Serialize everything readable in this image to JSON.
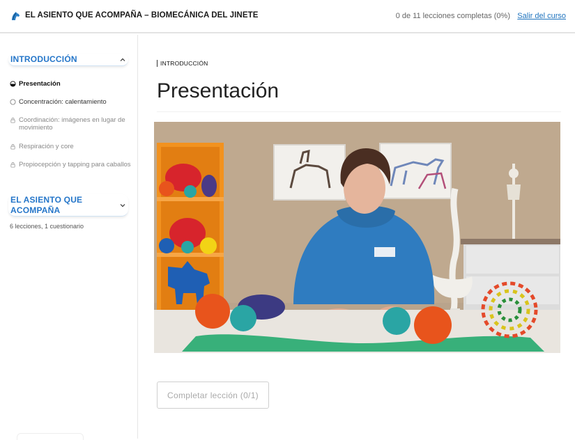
{
  "header": {
    "course_title": "EL ASIENTO QUE ACOMPAÑA – BIOMECÁNICA DEL JINETE",
    "progress": "0 de 11 lecciones completas (0%)",
    "exit_link": "Salir del curso",
    "logo_icon": "horse-head-logo-icon"
  },
  "sidebar": {
    "sections": [
      {
        "title": "INTRODUCCIÓN",
        "expanded": true,
        "chevron_icon": "chevron-up-icon",
        "lessons": [
          {
            "label": "Presentación",
            "state": "current",
            "icon": "half-circle-icon"
          },
          {
            "label": "Concentración: calentamiento",
            "state": "unlocked",
            "icon": "empty-circle-icon"
          },
          {
            "label": "Coordinación: imágenes en lugar de movimiento",
            "state": "locked",
            "icon": "lock-icon"
          },
          {
            "label": "Respiración y core",
            "state": "locked",
            "icon": "lock-icon"
          },
          {
            "label": "Propiocepción y tapping para caballos",
            "state": "locked",
            "icon": "lock-icon"
          }
        ]
      },
      {
        "title": "EL ASIENTO QUE ACOMPAÑA",
        "expanded": false,
        "chevron_icon": "chevron-down-icon",
        "meta": "6 lecciones, 1 cuestionario"
      }
    ]
  },
  "main": {
    "breadcrumb": "INTRODUCCIÓN",
    "title": "Presentación",
    "hero_image": "instructor-in-blue-hoodie-with-therapy-balls-and-spine-model",
    "complete_button": "Completar lección (0/1)"
  },
  "colors": {
    "accent": "#2576c9",
    "link": "#1e73be",
    "hoodie": "#2f7cc0"
  }
}
